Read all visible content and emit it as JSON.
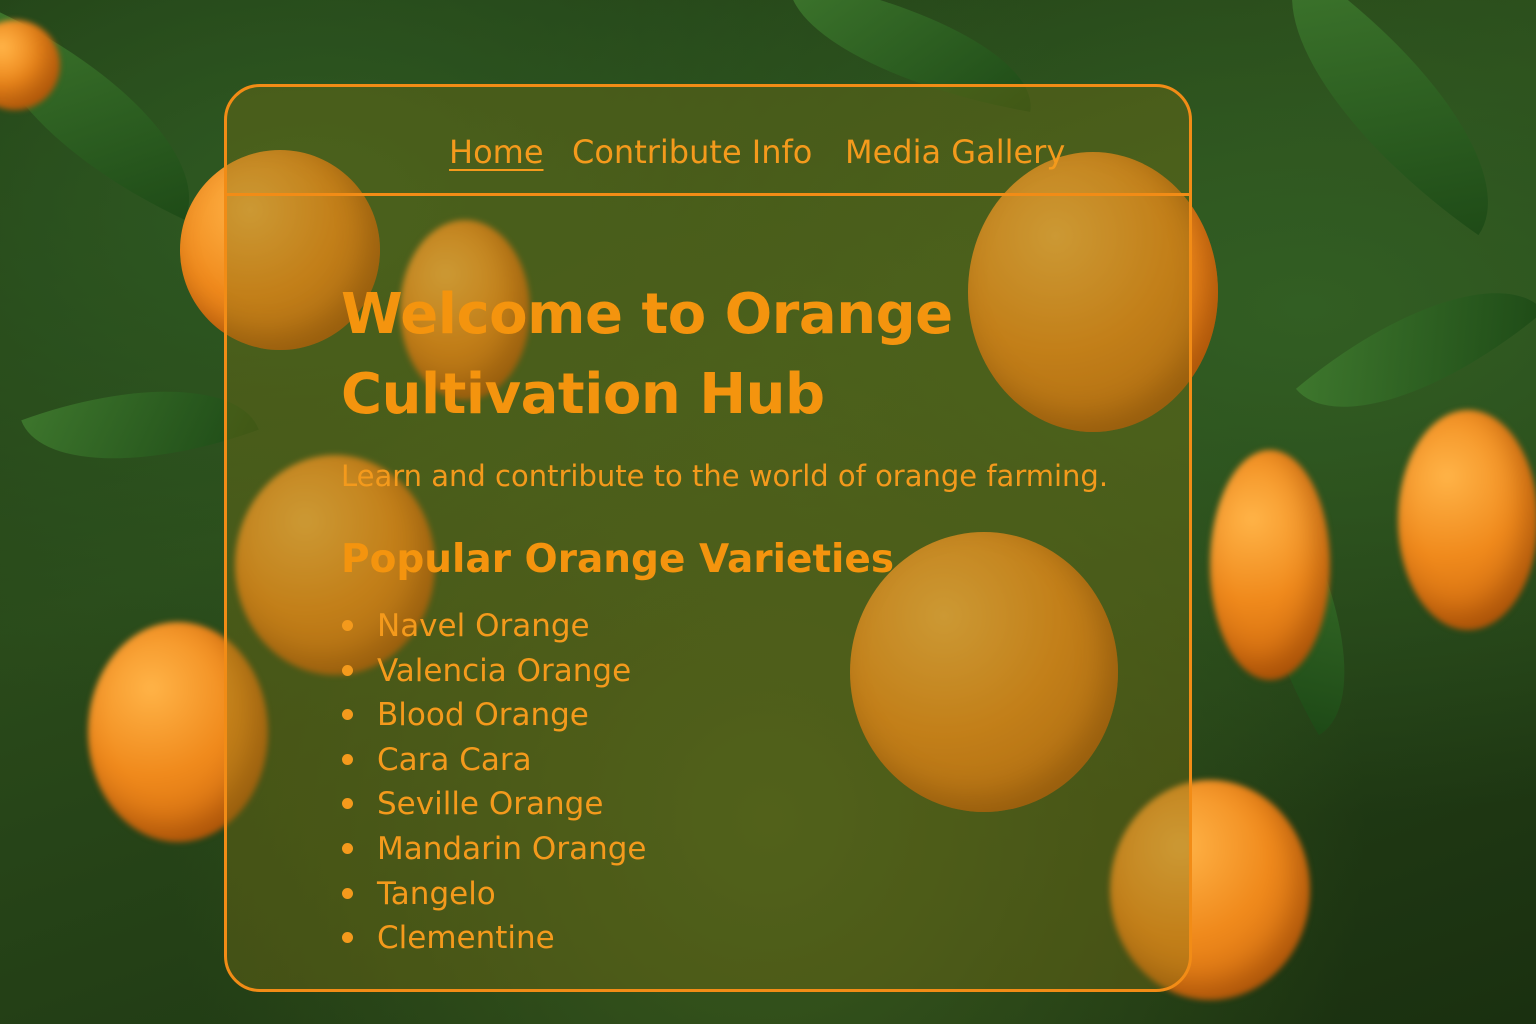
{
  "nav": {
    "items": [
      {
        "label": "Home",
        "active": true
      },
      {
        "label": "Contribute Info",
        "active": false
      },
      {
        "label": "Media Gallery",
        "active": false
      }
    ]
  },
  "hero": {
    "title": "Welcome to Orange Cultivation Hub",
    "subtitle": "Learn and contribute to the world of orange farming."
  },
  "varieties": {
    "heading": "Popular Orange Varieties",
    "items": [
      "Navel Orange",
      "Valencia Orange",
      "Blood Orange",
      "Cara Cara",
      "Seville Orange",
      "Mandarin Orange",
      "Tangelo",
      "Clementine"
    ]
  },
  "colors": {
    "accent": "#f28c16",
    "text": "#f49a1c",
    "panel_tint": "rgba(120,110,20,0.38)",
    "foliage": "#2a4a1a"
  },
  "icons": {
    "list_bullet": "bullet-dot-icon"
  }
}
